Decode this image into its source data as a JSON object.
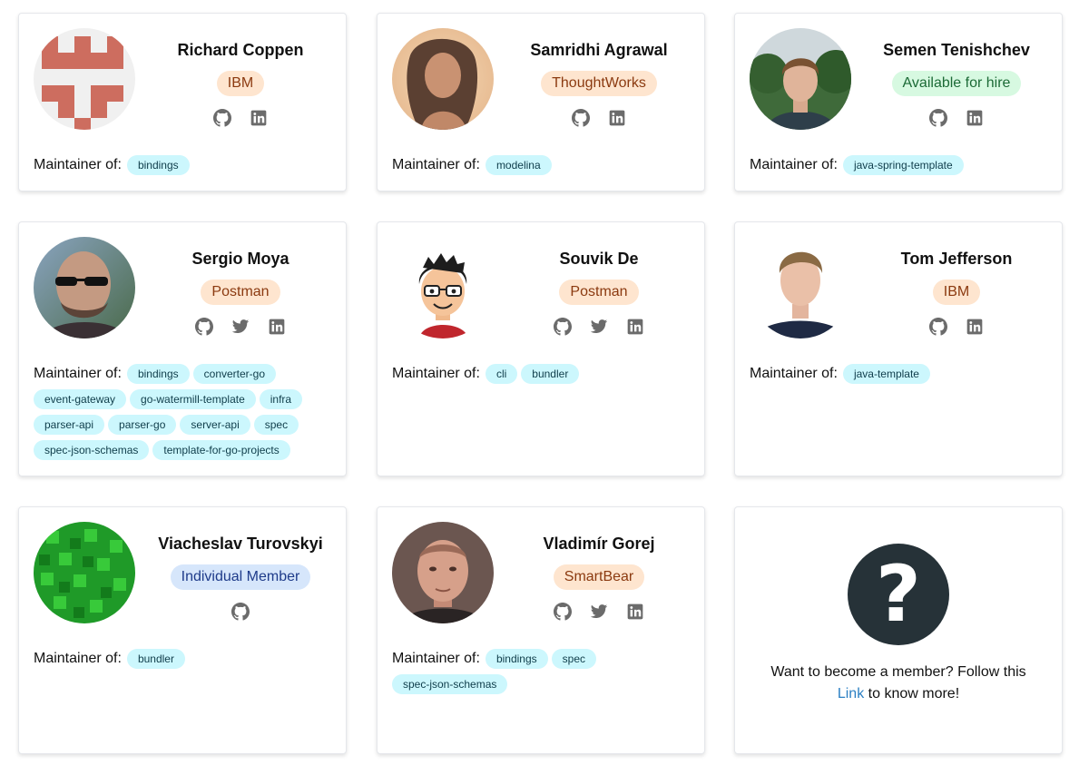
{
  "colors": {
    "badge_company_bg": "#fee5cf",
    "badge_company_text": "#8b3a10",
    "badge_hire_bg": "#d7f9e1",
    "badge_hire_text": "#1c6a36",
    "badge_individual_bg": "#d6e6fb",
    "badge_individual_text": "#1e3b8a",
    "tag_bg": "#ccf7fd",
    "icon_color": "#6b6b6b"
  },
  "maintainer_label": "Maintainer of:",
  "members": [
    {
      "name": "Richard Coppen",
      "badge": "IBM",
      "socials": [
        "github-icon",
        "linkedin-icon"
      ],
      "repos": [
        "bindings"
      ]
    },
    {
      "name": "Samridhi Agrawal",
      "badge": "ThoughtWorks",
      "socials": [
        "github-icon",
        "linkedin-icon"
      ],
      "repos": [
        "modelina"
      ]
    },
    {
      "name": "Semen Tenishchev",
      "badge": "Available for hire",
      "socials": [
        "github-icon",
        "linkedin-icon"
      ],
      "repos": [
        "java-spring-template"
      ]
    },
    {
      "name": "Sergio Moya",
      "badge": "Postman",
      "socials": [
        "github-icon",
        "twitter-icon",
        "linkedin-icon"
      ],
      "repos": [
        "bindings",
        "converter-go",
        "event-gateway",
        "go-watermill-template",
        "infra",
        "parser-api",
        "parser-go",
        "server-api",
        "spec",
        "spec-json-schemas",
        "template-for-go-projects"
      ]
    },
    {
      "name": "Souvik De",
      "badge": "Postman",
      "socials": [
        "github-icon",
        "twitter-icon",
        "linkedin-icon"
      ],
      "repos": [
        "cli",
        "bundler"
      ]
    },
    {
      "name": "Tom Jefferson",
      "badge": "IBM",
      "socials": [
        "github-icon",
        "linkedin-icon"
      ],
      "repos": [
        "java-template"
      ]
    },
    {
      "name": "Viacheslav Turovskyi",
      "badge": "Individual Member",
      "socials": [
        "github-icon"
      ],
      "repos": [
        "bundler"
      ]
    },
    {
      "name": "Vladimír Gorej",
      "badge": "SmartBear",
      "socials": [
        "github-icon",
        "twitter-icon",
        "linkedin-icon"
      ],
      "repos": [
        "bindings",
        "spec",
        "spec-json-schemas"
      ]
    }
  ],
  "join_card": {
    "symbol": "?",
    "text_before": "Want to become a member? Follow this",
    "link_text": "Link",
    "text_after": "to know more!"
  }
}
